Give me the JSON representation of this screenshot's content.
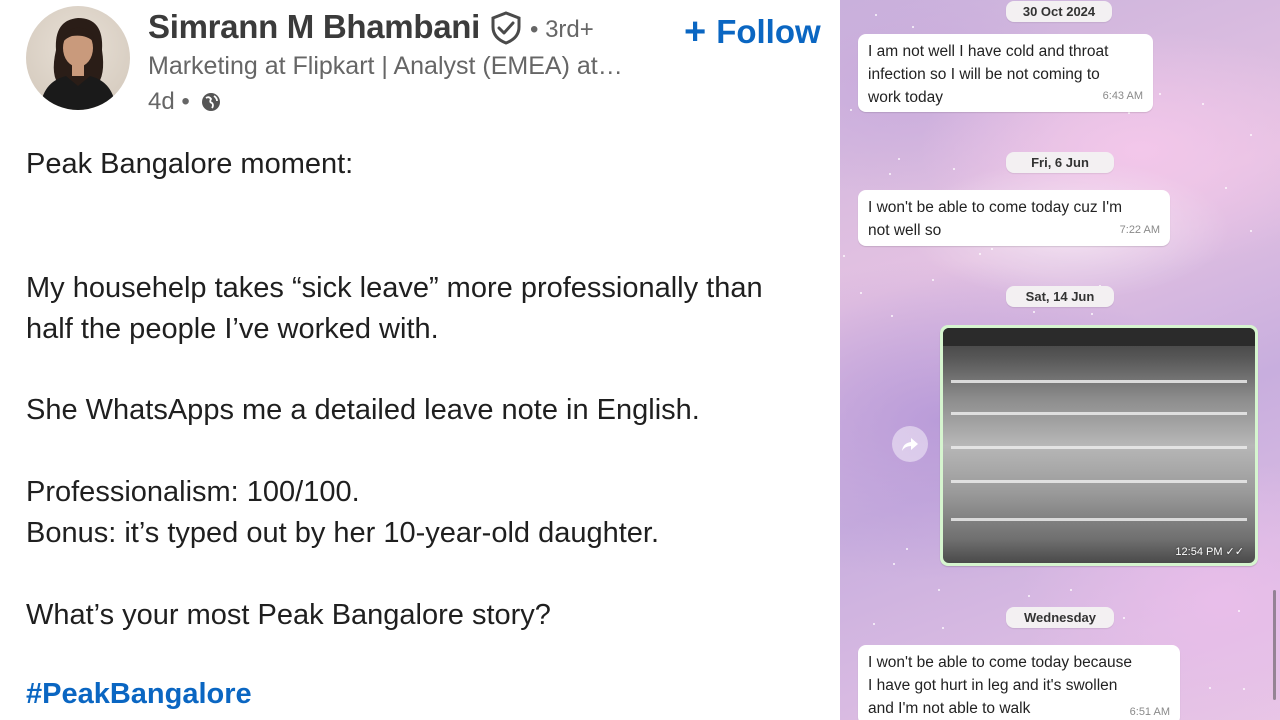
{
  "post": {
    "author_name": "Simrann M Bhambani",
    "degree": "• 3rd+",
    "headline": "Marketing at Flipkart | Analyst (EMEA) at…",
    "time_ago": "4d •",
    "follow_label": "Follow",
    "follow_plus": "+",
    "paragraphs": [
      "Peak Bangalore moment:",
      "My househelp takes “sick leave” more professionally than",
      "half the people I’ve worked with.",
      "She WhatsApps me a detailed leave note in English.",
      "Professionalism: 100/100.",
      "Bonus: it’s typed out by her 10-year-old daughter.",
      "What’s your most Peak Bangalore story?"
    ],
    "hashtag": "#PeakBangalore",
    "colors": {
      "link": "#0a66c2",
      "text": "#1f1f1f",
      "muted": "#666666"
    },
    "icons": [
      "verified-shield-icon",
      "globe-icon",
      "plus-icon"
    ]
  },
  "chat": {
    "messages": [
      {
        "date": "30 Oct 2024",
        "lines": [
          "I am not well I have cold and throat",
          "infection so I will be not coming to",
          "work today"
        ],
        "time": "6:43 AM"
      },
      {
        "date": "Fri, 6 Jun",
        "lines": [
          "I won't be able to come today cuz I'm",
          "not well so"
        ],
        "time": "7:22 AM"
      },
      {
        "date": "Sat, 14 Jun",
        "image": true,
        "time": "12:54 PM ✓✓"
      },
      {
        "date": "Wednesday",
        "lines": [
          "I won't be able to come today because",
          "I have got hurt in leg and it's swollen",
          "and I'm not able to walk"
        ],
        "time": "6:51 AM"
      }
    ],
    "colors": {
      "bubble": "#ffffff",
      "outgoing_bubble": "#d6f5cf",
      "date_chip": "#f3f0f2"
    },
    "icons": [
      "forward-icon"
    ]
  }
}
